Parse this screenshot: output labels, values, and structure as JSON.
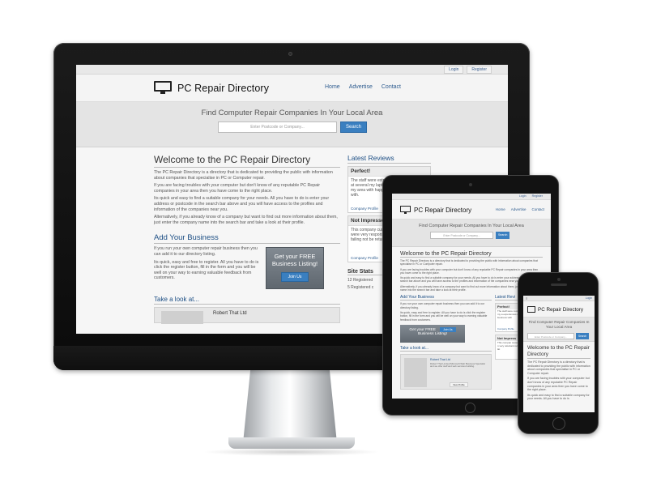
{
  "site": {
    "top_links": [
      "Login",
      "Register"
    ],
    "logo": "PC Repair Directory",
    "nav": [
      "Home",
      "Advertise",
      "Contact"
    ],
    "hero_title": "Find Computer Repair Companies In Your Local Area",
    "search_placeholder": "Enter Postcode or Company...",
    "search_button": "Search",
    "welcome_title": "Welcome to the PC Repair Directory",
    "welcome_paragraphs": [
      "The PC Repair Directory is a directory that is dedicated to providing the public with information about companies that specialise in PC or Computer repair.",
      "If you are facing troubles with your computer but don't know of any reputable PC Repair companies in your area then you have come to the right place.",
      "Its quick and easy to find a suitable company for your needs. All you have to do is enter your address or postcode in the search bar above and you will have access to the profiles and information of the companies near you.",
      "Alternatively, if you already know of a company but want to find out more information about them, just enter the company name into the search bar and take a look at their profile."
    ],
    "add_title": "Add Your Business",
    "add_paragraphs": [
      "If you run your own computer repair business then you can add it to our directory listing.",
      "Its quick, easy and free to register. All you have to do is click the register button, fill in the form and you will be well on your way to earning valuable feedback from customers."
    ],
    "promo_line1": "Get your FREE",
    "promo_line2": "Business Listing!",
    "promo_button": "Join Us",
    "look_title": "Take a look at...",
    "look_item_title": "Robert That Ltd",
    "reviews_title": "Latest Reviews",
    "reviews": [
      {
        "title": "Perfect!",
        "body": "The staff were extremely helpful customer at several my laptop when have to say that my area with happy to anyone business with.",
        "link": "Company Profile"
      },
      {
        "title": "Not Impressed",
        "body": "This company customer services but they were very responsibility when to the laptop failing not be returning to",
        "link": "Company Profile"
      }
    ],
    "stats_title": "Site Stats",
    "stats": [
      "12 Registered",
      "5 Registered c"
    ]
  },
  "tablet": {
    "top_links": [
      "Login",
      "Register"
    ],
    "logo": "PC Repair Directory",
    "nav": [
      "Home",
      "Advertise",
      "Contact"
    ],
    "hero_title": "Find Computer Repair Companies In Your Local Area",
    "search_placeholder": "Enter Postcode or Company...",
    "search_button": "Search",
    "welcome_title": "Welcome to the PC Repair Directory",
    "welcome_paragraphs": [
      "The PC Repair Directory is a directory that is dedicated to providing the public with information about companies that specialise in PC or Computer repair.",
      "If you are facing troubles with your computer but don't know of any reputable PC Repair companies in your area then you have come to the right place.",
      "Its quick and easy to find a suitable company for your needs. All you have to do is enter your address or postcode in the search bar above and you will have access to the profiles and information of the companies near you.",
      "Alternatively, if you already know of a company but want to find out more information about them, just enter the company name into the search bar and take a look at their profile."
    ],
    "add_title": "Add Your Business",
    "add_paragraphs": [
      "If you run your own computer repair business then you can add it to our directory listing.",
      "Its quick, easy and free to register. All you have to do is click the register button, fill in the form and you will be well on your way to earning valuable feedback from customers."
    ],
    "promo_line1": "Get your FREE",
    "promo_line2": "Business Listing!",
    "promo_button": "Join Us",
    "look_title": "Take a look at...",
    "look_item_title": "Robert That Ltd",
    "look_item_desc": "Robert That Limited Microsoft Web Business Specialist and we offer staff and web services building.",
    "look_item_button": "View Profile",
    "reviews_title": "Latest Revi",
    "reviews": [
      {
        "title": "Perfect!",
        "body": "The staff were customer at se shop in my a experiences o very happy t business with",
        "link": "Company Profile"
      },
      {
        "title": "Not Impress",
        "body": "This compan customer se would have n very reluctant return but th two days lat",
        "link": ""
      }
    ]
  },
  "phone": {
    "menu_icon": "≡",
    "top_link": "Login",
    "logo": "PC Repair Directory",
    "hero_title": "Find Computer Repair Companies In Your Local Area",
    "search_placeholder": "Enter Postcode or Company...",
    "search_button": "Search",
    "welcome_title": "Welcome to the PC Repair Directory",
    "welcome_paragraphs": [
      "The PC Repair Directory is a directory that is dedicated to providing the public with information about companies that specialise in PC or Computer repair.",
      "If you are facing troubles with your computer but don't know of any reputable PC Repair companies in your area then you have come to the right place.",
      "Its quick and easy to find a suitable company for your needs. All you have to do is"
    ]
  }
}
